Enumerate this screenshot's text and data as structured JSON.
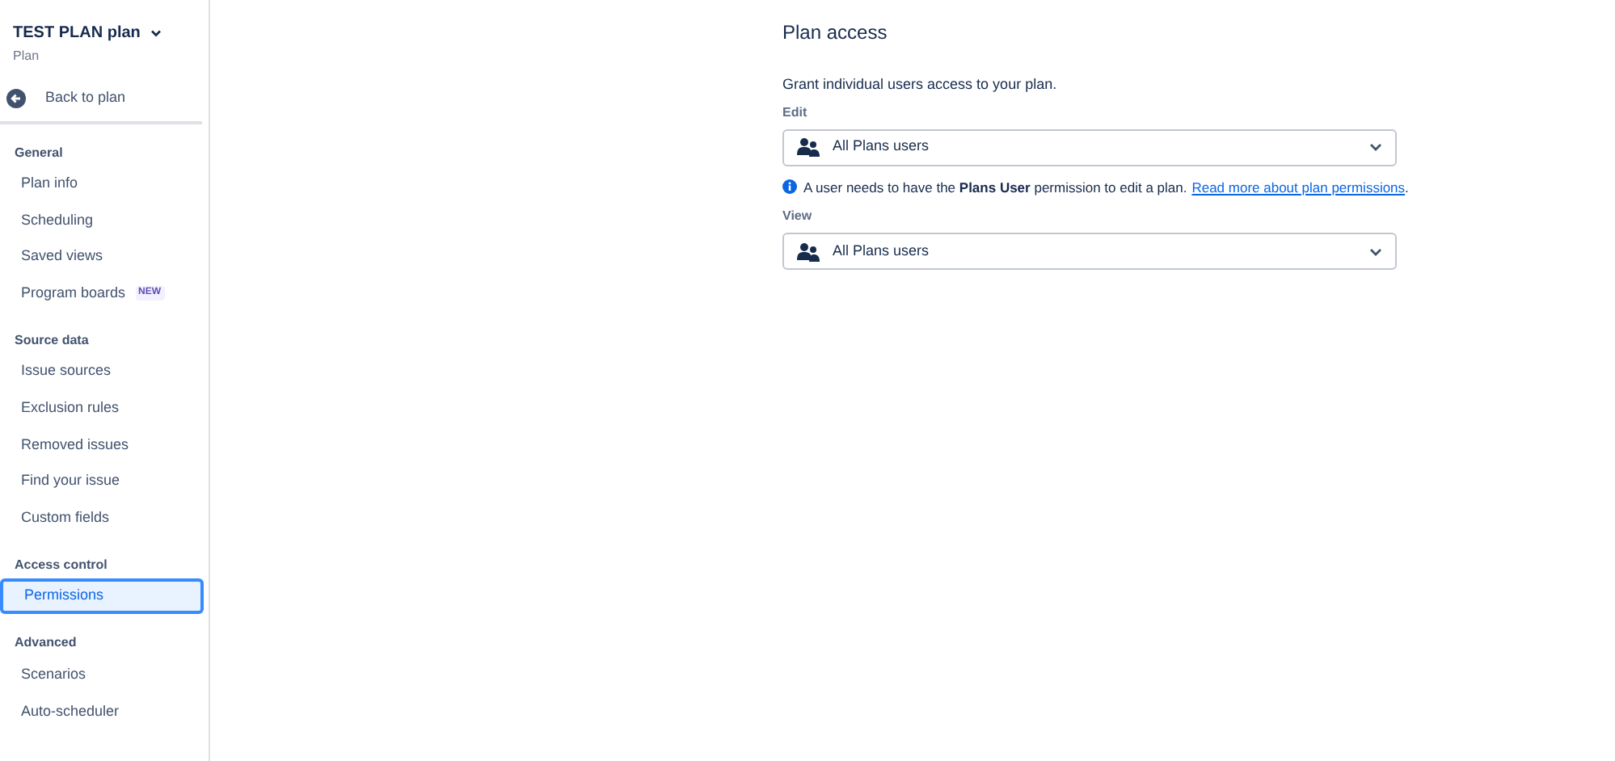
{
  "sidebar": {
    "plan_name": "TEST PLAN plan",
    "plan_subtitle": "Plan",
    "back_link": "Back to plan",
    "sections": [
      {
        "title": "General",
        "items": [
          {
            "label": "Plan info",
            "selected": false
          },
          {
            "label": "Scheduling",
            "selected": false
          },
          {
            "label": "Saved views",
            "selected": false
          },
          {
            "label": "Program boards",
            "badge": "NEW",
            "selected": false
          }
        ]
      },
      {
        "title": "Source data",
        "items": [
          {
            "label": "Issue sources",
            "selected": false
          },
          {
            "label": "Exclusion rules",
            "selected": false
          },
          {
            "label": "Removed issues",
            "selected": false
          },
          {
            "label": "Find your issue",
            "selected": false
          },
          {
            "label": "Custom fields",
            "selected": false
          }
        ]
      },
      {
        "title": "Access control",
        "items": [
          {
            "label": "Permissions",
            "selected": true
          }
        ]
      },
      {
        "title": "Advanced",
        "items": [
          {
            "label": "Scenarios",
            "selected": false
          },
          {
            "label": "Auto-scheduler",
            "selected": false
          }
        ]
      }
    ]
  },
  "main": {
    "title": "Plan access",
    "description": "Grant individual users access to your plan.",
    "edit": {
      "label": "Edit",
      "value": "All Plans users"
    },
    "info": {
      "message": "A user needs to have the **Plans User** permission to edit a plan.",
      "link": "Read more about plan permissions",
      "trailing": "."
    },
    "view": {
      "label": "View",
      "value": "All Plans users"
    }
  }
}
